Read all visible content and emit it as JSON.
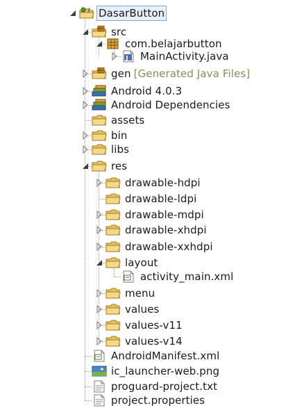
{
  "tree": [
    {
      "label": "DasarButton",
      "icon": "android-project-icon",
      "toggle": "expanded",
      "selected": true
    },
    {
      "label": "src",
      "icon": "source-folder-icon",
      "toggle": "expanded"
    },
    {
      "label": "com.belajarbutton",
      "icon": "package-icon",
      "toggle": "expanded"
    },
    {
      "label": "MainActivity.java",
      "icon": "java-file-icon",
      "toggle": "collapsed"
    },
    {
      "label": "gen",
      "decoration": "[Generated Java Files]",
      "icon": "source-folder-icon",
      "toggle": "collapsed"
    },
    {
      "label": "Android 4.0.3",
      "icon": "library-icon",
      "toggle": "collapsed"
    },
    {
      "label": "Android Dependencies",
      "icon": "library-icon",
      "toggle": "collapsed"
    },
    {
      "label": "assets",
      "icon": "folder-icon",
      "toggle": "none"
    },
    {
      "label": "bin",
      "icon": "folder-icon",
      "toggle": "collapsed"
    },
    {
      "label": "libs",
      "icon": "folder-icon",
      "toggle": "collapsed"
    },
    {
      "label": "res",
      "icon": "folder-icon",
      "toggle": "expanded"
    },
    {
      "label": "drawable-hdpi",
      "icon": "folder-icon",
      "toggle": "collapsed"
    },
    {
      "label": "drawable-ldpi",
      "icon": "folder-icon",
      "toggle": "none"
    },
    {
      "label": "drawable-mdpi",
      "icon": "folder-icon",
      "toggle": "collapsed"
    },
    {
      "label": "drawable-xhdpi",
      "icon": "folder-icon",
      "toggle": "collapsed"
    },
    {
      "label": "drawable-xxhdpi",
      "icon": "folder-icon",
      "toggle": "collapsed"
    },
    {
      "label": "layout",
      "icon": "folder-icon",
      "toggle": "expanded"
    },
    {
      "label": "activity_main.xml",
      "icon": "xml-file-icon",
      "toggle": "none"
    },
    {
      "label": "menu",
      "icon": "folder-icon",
      "toggle": "collapsed"
    },
    {
      "label": "values",
      "icon": "folder-icon",
      "toggle": "collapsed"
    },
    {
      "label": "values-v11",
      "icon": "folder-icon",
      "toggle": "collapsed"
    },
    {
      "label": "values-v14",
      "icon": "folder-icon",
      "toggle": "collapsed"
    },
    {
      "label": "AndroidManifest.xml",
      "icon": "xml-file-icon",
      "toggle": "none"
    },
    {
      "label": "ic_launcher-web.png",
      "icon": "image-file-icon",
      "toggle": "none"
    },
    {
      "label": "proguard-project.txt",
      "icon": "text-file-icon",
      "toggle": "none"
    },
    {
      "label": "project.properties",
      "icon": "text-file-icon",
      "toggle": "none"
    }
  ],
  "colors": {
    "selection_bg": "#e6f0fb",
    "selection_border": "#7ea7d8",
    "decoration_text": "#8b8b5c",
    "folder": "#e8c25a"
  }
}
